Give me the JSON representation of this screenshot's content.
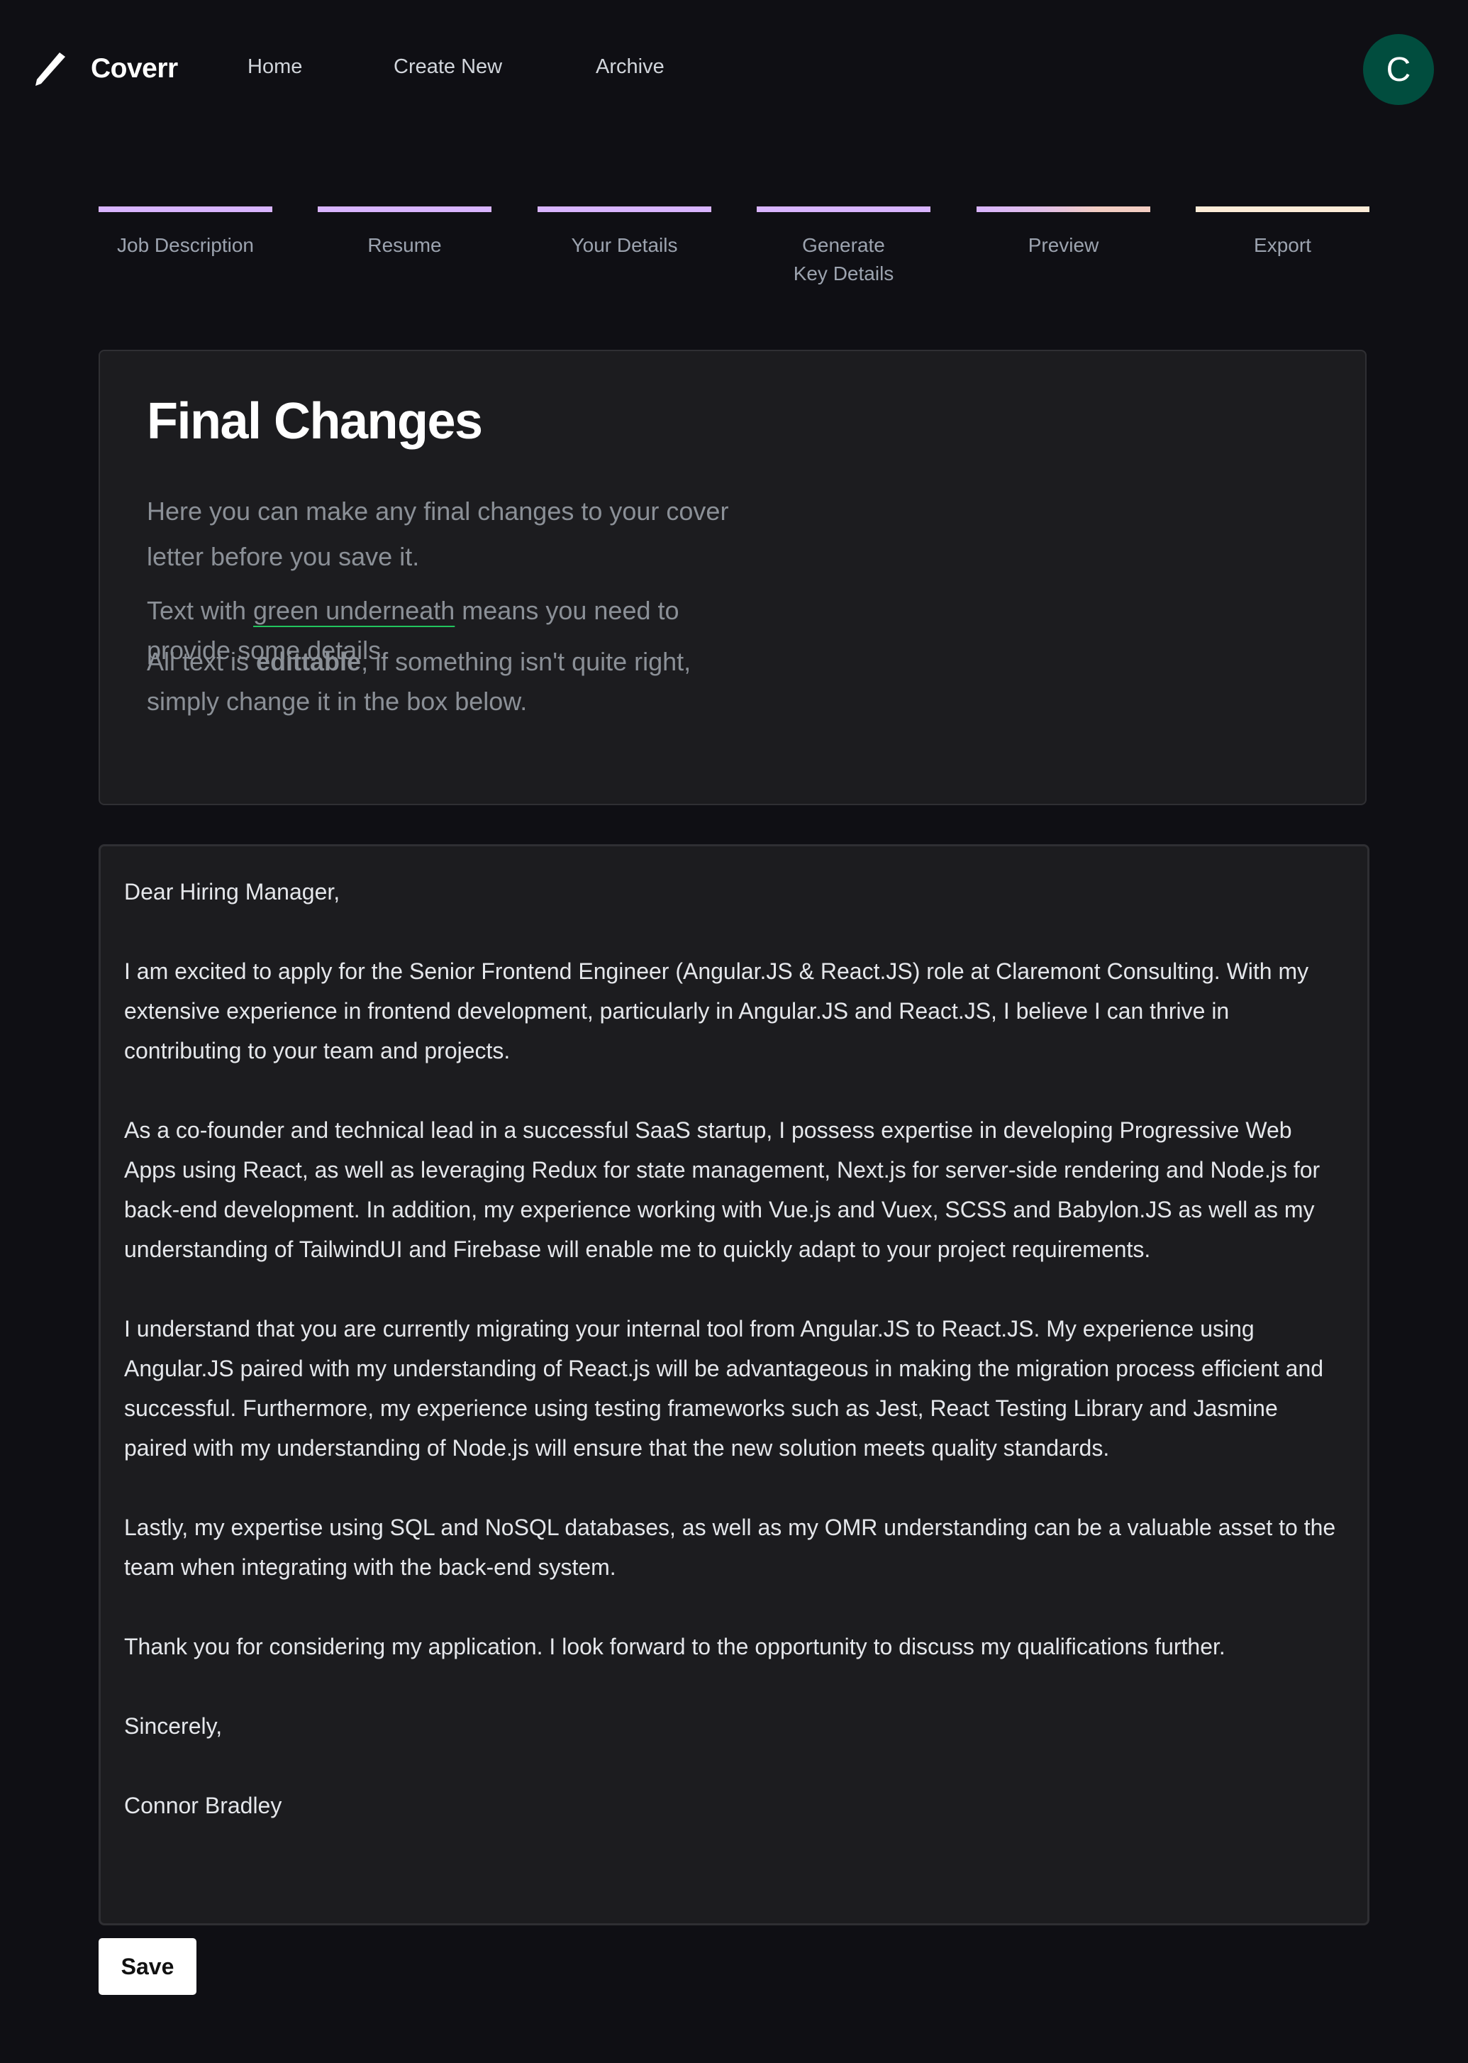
{
  "app": {
    "name": "Coverr",
    "logo_icon": "pen-icon"
  },
  "nav": {
    "items": [
      {
        "label": "Home"
      },
      {
        "label": "Create New"
      },
      {
        "label": "Archive"
      }
    ]
  },
  "user": {
    "avatar_initial": "C",
    "avatar_color": "#014d3e"
  },
  "stepper": {
    "steps": [
      {
        "label": "Job Description",
        "status": "complete"
      },
      {
        "label": "Resume",
        "status": "complete"
      },
      {
        "label": "Your Details",
        "status": "complete"
      },
      {
        "label": "Generate Key Details",
        "status": "complete"
      },
      {
        "label": "Preview",
        "status": "current"
      },
      {
        "label": "Export",
        "status": "upcoming"
      }
    ],
    "colors": {
      "complete": "#d8b4fe",
      "current_gradient_end": "#f3cdc2",
      "upcoming": "#fdecd7"
    }
  },
  "intro": {
    "title": "Final Changes",
    "p1": "Here you can make any final changes to your cover letter before you save it.",
    "p2_before": "Text with ",
    "p2_highlight": "green underneath",
    "p2_after": " means you need to provide some details.",
    "p3_before": "All text is ",
    "p3_bold": "edittable",
    "p3_after": ", if something isn't quite right, simply change it in the box below.",
    "highlight_color": "#22c55e"
  },
  "letter": {
    "paragraphs": [
      "Dear Hiring Manager,",
      "I am excited to apply for the Senior Frontend Engineer (Angular.JS & React.JS) role at Claremont Consulting. With my extensive experience in frontend development, particularly in Angular.JS and React.JS, I believe I can thrive in contributing to your team and projects.",
      "As a co-founder and technical lead in a successful SaaS startup, I possess expertise in developing Progressive Web Apps using React, as well as leveraging Redux for state management, Next.js for server-side rendering and Node.js for back-end development. In addition, my experience working with Vue.js and Vuex, SCSS and Babylon.JS as well as my understanding of TailwindUI and Firebase will enable me to quickly adapt to your project requirements.",
      "I understand that you are currently migrating your internal tool from Angular.JS to React.JS. My experience using Angular.JS paired with my understanding of React.js will be advantageous in making the migration process efficient and successful. Furthermore, my experience using testing frameworks such as Jest, React Testing Library and Jasmine paired with my understanding of Node.js will ensure that the new solution meets quality standards.",
      "Lastly, my expertise using SQL and NoSQL databases, as well as my OMR understanding can be a valuable asset to the team when integrating with the back-end system.",
      "Thank you for considering my application. I look forward to the opportunity to discuss my qualifications further.",
      "Sincerely,",
      "Connor Bradley"
    ]
  },
  "actions": {
    "save_label": "Save"
  }
}
